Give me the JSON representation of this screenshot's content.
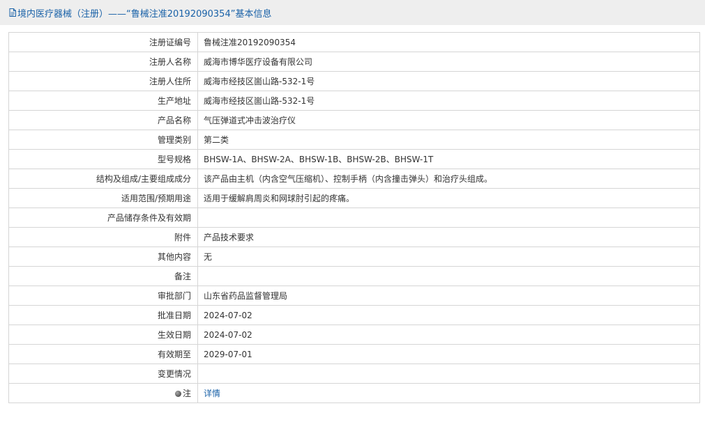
{
  "header": {
    "title": "境内医疗器械（注册）——“鲁械注准20192090354”基本信息",
    "icon": "document-icon"
  },
  "rows": [
    {
      "label": "注册证编号",
      "value": "鲁械注准20192090354"
    },
    {
      "label": "注册人名称",
      "value": "威海市博华医疗设备有限公司"
    },
    {
      "label": "注册人住所",
      "value": "威海市经技区崮山路-532-1号"
    },
    {
      "label": "生产地址",
      "value": "威海市经技区崮山路-532-1号"
    },
    {
      "label": "产品名称",
      "value": "气压弹道式冲击波治疗仪"
    },
    {
      "label": "管理类别",
      "value": "第二类"
    },
    {
      "label": "型号规格",
      "value": "BHSW-1A、BHSW-2A、BHSW-1B、BHSW-2B、BHSW-1T"
    },
    {
      "label": "结构及组成/主要组成成分",
      "value": "该产品由主机（内含空气压缩机）、控制手柄（内含撞击弹头）和治疗头组成。"
    },
    {
      "label": "适用范围/预期用途",
      "value": "适用于缓解肩周炎和网球肘引起的疼痛。"
    },
    {
      "label": "产品储存条件及有效期",
      "value": ""
    },
    {
      "label": "附件",
      "value": "产品技术要求"
    },
    {
      "label": "其他内容",
      "value": "无"
    },
    {
      "label": "备注",
      "value": ""
    },
    {
      "label": "审批部门",
      "value": "山东省药品监督管理局"
    },
    {
      "label": "批准日期",
      "value": "2024-07-02"
    },
    {
      "label": "生效日期",
      "value": "2024-07-02"
    },
    {
      "label": "有效期至",
      "value": "2029-07-01"
    },
    {
      "label": "变更情况",
      "value": ""
    }
  ],
  "note_row": {
    "label": "注",
    "icon": "info-dot-icon",
    "link_text": "详情"
  },
  "colors": {
    "title_bar_bg": "#eeeeee",
    "link": "#1a62a8",
    "border": "#d5d5d5"
  }
}
